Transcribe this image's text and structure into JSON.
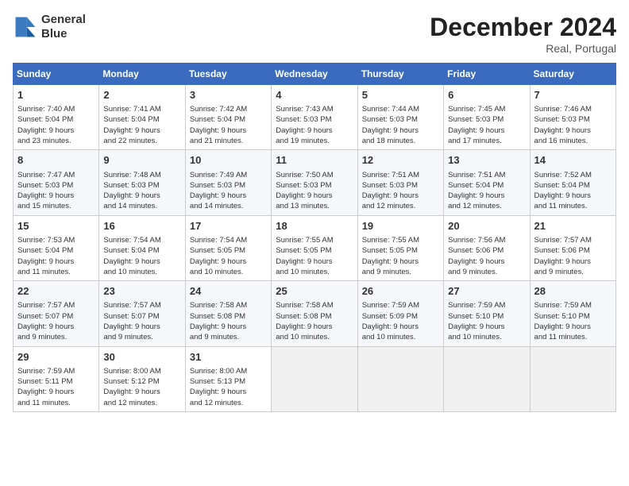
{
  "header": {
    "logo_line1": "General",
    "logo_line2": "Blue",
    "month_year": "December 2024",
    "location": "Real, Portugal"
  },
  "weekdays": [
    "Sunday",
    "Monday",
    "Tuesday",
    "Wednesday",
    "Thursday",
    "Friday",
    "Saturday"
  ],
  "weeks": [
    [
      {
        "day": "1",
        "info": "Sunrise: 7:40 AM\nSunset: 5:04 PM\nDaylight: 9 hours\nand 23 minutes."
      },
      {
        "day": "2",
        "info": "Sunrise: 7:41 AM\nSunset: 5:04 PM\nDaylight: 9 hours\nand 22 minutes."
      },
      {
        "day": "3",
        "info": "Sunrise: 7:42 AM\nSunset: 5:04 PM\nDaylight: 9 hours\nand 21 minutes."
      },
      {
        "day": "4",
        "info": "Sunrise: 7:43 AM\nSunset: 5:03 PM\nDaylight: 9 hours\nand 19 minutes."
      },
      {
        "day": "5",
        "info": "Sunrise: 7:44 AM\nSunset: 5:03 PM\nDaylight: 9 hours\nand 18 minutes."
      },
      {
        "day": "6",
        "info": "Sunrise: 7:45 AM\nSunset: 5:03 PM\nDaylight: 9 hours\nand 17 minutes."
      },
      {
        "day": "7",
        "info": "Sunrise: 7:46 AM\nSunset: 5:03 PM\nDaylight: 9 hours\nand 16 minutes."
      }
    ],
    [
      {
        "day": "8",
        "info": "Sunrise: 7:47 AM\nSunset: 5:03 PM\nDaylight: 9 hours\nand 15 minutes."
      },
      {
        "day": "9",
        "info": "Sunrise: 7:48 AM\nSunset: 5:03 PM\nDaylight: 9 hours\nand 14 minutes."
      },
      {
        "day": "10",
        "info": "Sunrise: 7:49 AM\nSunset: 5:03 PM\nDaylight: 9 hours\nand 14 minutes."
      },
      {
        "day": "11",
        "info": "Sunrise: 7:50 AM\nSunset: 5:03 PM\nDaylight: 9 hours\nand 13 minutes."
      },
      {
        "day": "12",
        "info": "Sunrise: 7:51 AM\nSunset: 5:03 PM\nDaylight: 9 hours\nand 12 minutes."
      },
      {
        "day": "13",
        "info": "Sunrise: 7:51 AM\nSunset: 5:04 PM\nDaylight: 9 hours\nand 12 minutes."
      },
      {
        "day": "14",
        "info": "Sunrise: 7:52 AM\nSunset: 5:04 PM\nDaylight: 9 hours\nand 11 minutes."
      }
    ],
    [
      {
        "day": "15",
        "info": "Sunrise: 7:53 AM\nSunset: 5:04 PM\nDaylight: 9 hours\nand 11 minutes."
      },
      {
        "day": "16",
        "info": "Sunrise: 7:54 AM\nSunset: 5:04 PM\nDaylight: 9 hours\nand 10 minutes."
      },
      {
        "day": "17",
        "info": "Sunrise: 7:54 AM\nSunset: 5:05 PM\nDaylight: 9 hours\nand 10 minutes."
      },
      {
        "day": "18",
        "info": "Sunrise: 7:55 AM\nSunset: 5:05 PM\nDaylight: 9 hours\nand 10 minutes."
      },
      {
        "day": "19",
        "info": "Sunrise: 7:55 AM\nSunset: 5:05 PM\nDaylight: 9 hours\nand 9 minutes."
      },
      {
        "day": "20",
        "info": "Sunrise: 7:56 AM\nSunset: 5:06 PM\nDaylight: 9 hours\nand 9 minutes."
      },
      {
        "day": "21",
        "info": "Sunrise: 7:57 AM\nSunset: 5:06 PM\nDaylight: 9 hours\nand 9 minutes."
      }
    ],
    [
      {
        "day": "22",
        "info": "Sunrise: 7:57 AM\nSunset: 5:07 PM\nDaylight: 9 hours\nand 9 minutes."
      },
      {
        "day": "23",
        "info": "Sunrise: 7:57 AM\nSunset: 5:07 PM\nDaylight: 9 hours\nand 9 minutes."
      },
      {
        "day": "24",
        "info": "Sunrise: 7:58 AM\nSunset: 5:08 PM\nDaylight: 9 hours\nand 9 minutes."
      },
      {
        "day": "25",
        "info": "Sunrise: 7:58 AM\nSunset: 5:08 PM\nDaylight: 9 hours\nand 10 minutes."
      },
      {
        "day": "26",
        "info": "Sunrise: 7:59 AM\nSunset: 5:09 PM\nDaylight: 9 hours\nand 10 minutes."
      },
      {
        "day": "27",
        "info": "Sunrise: 7:59 AM\nSunset: 5:10 PM\nDaylight: 9 hours\nand 10 minutes."
      },
      {
        "day": "28",
        "info": "Sunrise: 7:59 AM\nSunset: 5:10 PM\nDaylight: 9 hours\nand 11 minutes."
      }
    ],
    [
      {
        "day": "29",
        "info": "Sunrise: 7:59 AM\nSunset: 5:11 PM\nDaylight: 9 hours\nand 11 minutes."
      },
      {
        "day": "30",
        "info": "Sunrise: 8:00 AM\nSunset: 5:12 PM\nDaylight: 9 hours\nand 12 minutes."
      },
      {
        "day": "31",
        "info": "Sunrise: 8:00 AM\nSunset: 5:13 PM\nDaylight: 9 hours\nand 12 minutes."
      },
      {
        "day": "",
        "info": ""
      },
      {
        "day": "",
        "info": ""
      },
      {
        "day": "",
        "info": ""
      },
      {
        "day": "",
        "info": ""
      }
    ]
  ]
}
